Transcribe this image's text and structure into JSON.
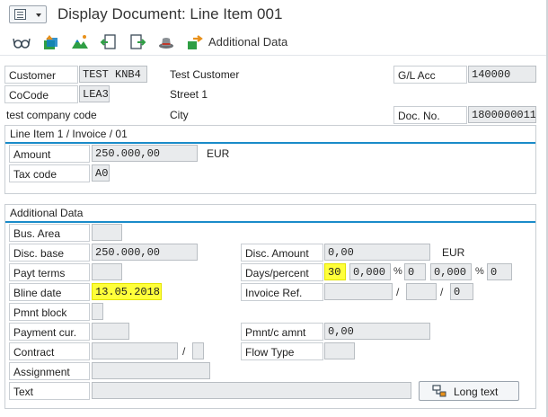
{
  "window": {
    "title": "Display Document: Line Item 001"
  },
  "toolbar": {
    "additional_data_label": "Additional Data"
  },
  "header": {
    "customer_label": "Customer",
    "customer_value": "TEST KNB4",
    "customer_name": "Test Customer",
    "cocode_label": "CoCode",
    "cocode_value": "LEA3",
    "street": "Street 1",
    "company_name": "test company code",
    "city": "City",
    "gl_acc_label": "G/L Acc",
    "gl_acc_value": "140000",
    "doc_no_label": "Doc. No.",
    "doc_no_value": "1800000011"
  },
  "line_item": {
    "title": "Line Item 1 / Invoice / 01",
    "amount_label": "Amount",
    "amount_value": "250.000,00",
    "currency": "EUR",
    "tax_code_label": "Tax code",
    "tax_code_value": "A0"
  },
  "additional": {
    "title": "Additional Data",
    "bus_area_label": "Bus. Area",
    "bus_area_value": "",
    "disc_base_label": "Disc. base",
    "disc_base_value": "250.000,00",
    "payt_terms_label": "Payt terms",
    "payt_terms_value": "",
    "bline_date_label": "Bline date",
    "bline_date_value": "13.05.2018",
    "pmnt_block_label": "Pmnt block",
    "pmnt_block_value": "",
    "payment_cur_label": "Payment cur.",
    "payment_cur_value": "",
    "contract_label": "Contract",
    "contract_sep": "/",
    "assignment_label": "Assignment",
    "text_label": "Text",
    "disc_amount_label": "Disc. Amount",
    "disc_amount_value": "0,00",
    "disc_currency": "EUR",
    "days_percent_label": "Days/percent",
    "days1": "30",
    "pct1": "0,000",
    "pct_sign": "%",
    "days2": "0",
    "pct2": "0,000",
    "days3": "0",
    "invoice_ref_label": "Invoice Ref.",
    "invoice_ref_sep": "/",
    "invoice_ref_item": "0",
    "pmnt_amnt_label": "Pmnt/c amnt",
    "pmnt_amnt_value": "0,00",
    "flow_type_label": "Flow Type",
    "long_text_button": "Long text"
  },
  "colors": {
    "group_accent": "#1a8bc9",
    "highlight": "#ffff3a",
    "field_bg": "#e9ebed"
  }
}
